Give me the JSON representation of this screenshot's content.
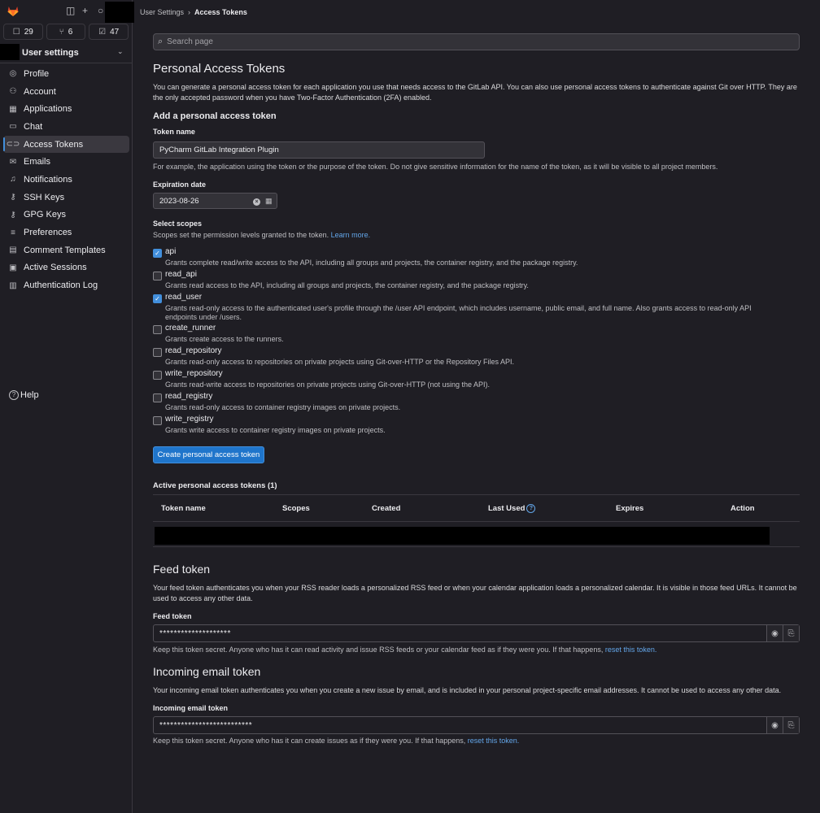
{
  "breadcrumb": {
    "parent": "User Settings",
    "current": "Access Tokens"
  },
  "topbar": {
    "counters": [
      {
        "icon": "issues-icon",
        "glyph": "☐",
        "value": "29"
      },
      {
        "icon": "merge-request-icon",
        "glyph": "⑂",
        "value": "6"
      },
      {
        "icon": "todo-icon",
        "glyph": "☑",
        "value": "47"
      }
    ]
  },
  "sidebar": {
    "context_title": "User settings",
    "items": [
      {
        "label": "Profile",
        "icon": "profile-icon",
        "glyph": "◎"
      },
      {
        "label": "Account",
        "icon": "account-icon",
        "glyph": "⚇"
      },
      {
        "label": "Applications",
        "icon": "applications-icon",
        "glyph": "▦"
      },
      {
        "label": "Chat",
        "icon": "chat-icon",
        "glyph": "▭"
      },
      {
        "label": "Access Tokens",
        "icon": "token-icon",
        "glyph": "⊂⊃",
        "active": true
      },
      {
        "label": "Emails",
        "icon": "mail-icon",
        "glyph": "✉"
      },
      {
        "label": "Notifications",
        "icon": "notifications-icon",
        "glyph": "♫"
      },
      {
        "label": "SSH Keys",
        "icon": "key-icon",
        "glyph": "⚷"
      },
      {
        "label": "GPG Keys",
        "icon": "key-icon",
        "glyph": "⚷"
      },
      {
        "label": "Preferences",
        "icon": "preferences-icon",
        "glyph": "≡"
      },
      {
        "label": "Comment Templates",
        "icon": "comment-templates-icon",
        "glyph": "▤"
      },
      {
        "label": "Active Sessions",
        "icon": "sessions-icon",
        "glyph": "▣"
      },
      {
        "label": "Authentication Log",
        "icon": "log-icon",
        "glyph": "▥"
      }
    ],
    "help_label": "Help"
  },
  "search": {
    "placeholder": "Search page"
  },
  "pat": {
    "title": "Personal Access Tokens",
    "description": "You can generate a personal access token for each application you use that needs access to the GitLab API. You can also use personal access tokens to authenticate against Git over HTTP. They are the only accepted password when you have Two-Factor Authentication (2FA) enabled.",
    "add_title": "Add a personal access token",
    "token_name_label": "Token name",
    "token_name_value": "PyCharm GitLab Integration Plugin",
    "token_name_help": "For example, the application using the token or the purpose of the token. Do not give sensitive information for the name of the token, as it will be visible to all project members.",
    "expiration_label": "Expiration date",
    "expiration_value": "2023-08-26",
    "scopes_label": "Select scopes",
    "scopes_help": "Scopes set the permission levels granted to the token.",
    "learn_more": "Learn more.",
    "scopes": [
      {
        "name": "api",
        "checked": true,
        "desc": "Grants complete read/write access to the API, including all groups and projects, the container registry, and the package registry."
      },
      {
        "name": "read_api",
        "checked": false,
        "desc": "Grants read access to the API, including all groups and projects, the container registry, and the package registry."
      },
      {
        "name": "read_user",
        "checked": true,
        "desc": "Grants read-only access to the authenticated user's profile through the /user API endpoint, which includes username, public email, and full name. Also grants access to read-only API endpoints under /users."
      },
      {
        "name": "create_runner",
        "checked": false,
        "desc": "Grants create access to the runners."
      },
      {
        "name": "read_repository",
        "checked": false,
        "desc": "Grants read-only access to repositories on private projects using Git-over-HTTP or the Repository Files API."
      },
      {
        "name": "write_repository",
        "checked": false,
        "desc": "Grants read-write access to repositories on private projects using Git-over-HTTP (not using the API)."
      },
      {
        "name": "read_registry",
        "checked": false,
        "desc": "Grants read-only access to container registry images on private projects."
      },
      {
        "name": "write_registry",
        "checked": false,
        "desc": "Grants write access to container registry images on private projects."
      }
    ],
    "create_button": "Create personal access token",
    "active_title": "Active personal access tokens (1)",
    "table_headers": [
      "Token name",
      "Scopes",
      "Created",
      "Last Used",
      "Expires",
      "Action"
    ]
  },
  "feed": {
    "title": "Feed token",
    "description": "Your feed token authenticates you when your RSS reader loads a personalized RSS feed or when your calendar application loads a personalized calendar. It is visible in those feed URLs. It cannot be used to access any other data.",
    "label": "Feed token",
    "value": "********************",
    "help_prefix": "Keep this token secret. Anyone who has it can read activity and issue RSS feeds or your calendar feed as if they were you. If that happens,",
    "help_link": "reset this token."
  },
  "incoming": {
    "title": "Incoming email token",
    "description": "Your incoming email token authenticates you when you create a new issue by email, and is included in your personal project-specific email addresses. It cannot be used to access any other data.",
    "label": "Incoming email token",
    "value": "**************************",
    "help_prefix": "Keep this token secret. Anyone who has it can create issues as if they were you. If that happens,",
    "help_link": "reset this token."
  },
  "colors": {
    "accent": "#428fdc",
    "button": "#1f75cb",
    "link": "#63a6e9",
    "background": "#1f1e24"
  }
}
